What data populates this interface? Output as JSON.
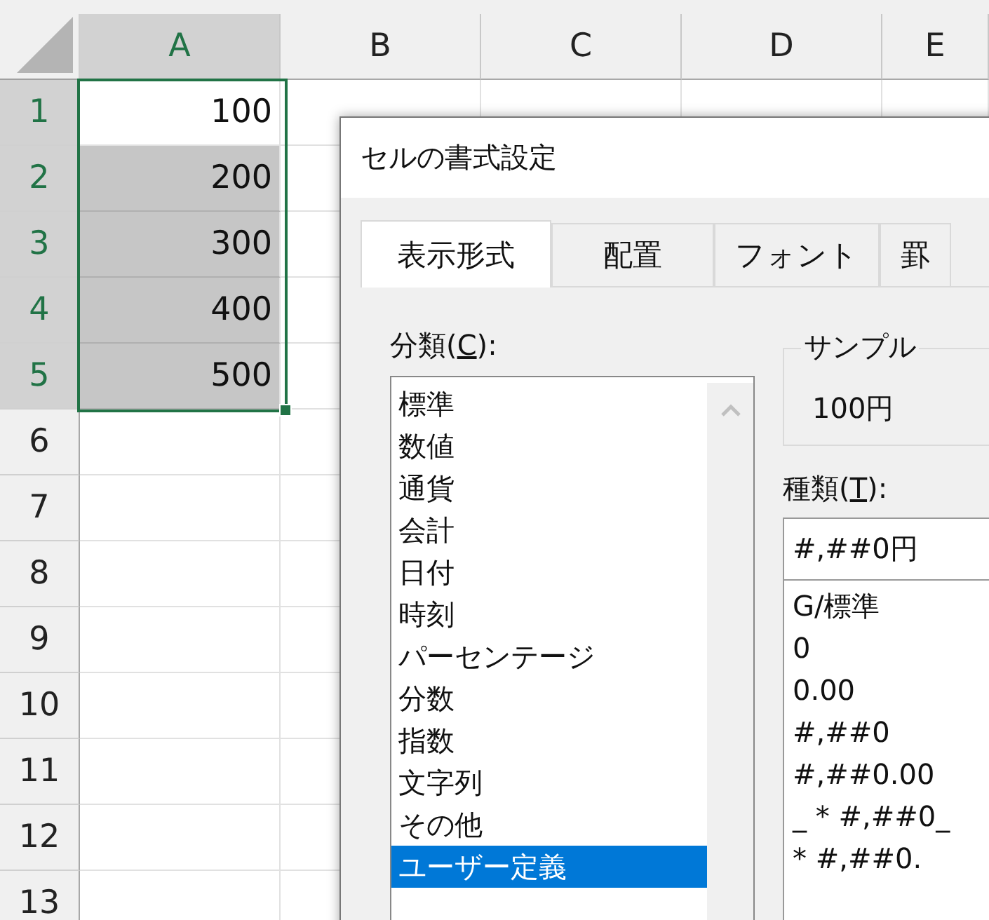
{
  "sheet": {
    "columns": [
      {
        "label": "A",
        "selected": true
      },
      {
        "label": "B",
        "selected": false
      },
      {
        "label": "C",
        "selected": false
      },
      {
        "label": "D",
        "selected": false
      },
      {
        "label": "E",
        "selected": false
      }
    ],
    "rows": [
      {
        "number": "1",
        "selected": true,
        "cells": [
          {
            "value": "100",
            "selected": true,
            "active": true
          }
        ]
      },
      {
        "number": "2",
        "selected": true,
        "cells": [
          {
            "value": "200",
            "selected": true,
            "active": false
          }
        ]
      },
      {
        "number": "3",
        "selected": true,
        "cells": [
          {
            "value": "300",
            "selected": true,
            "active": false
          }
        ]
      },
      {
        "number": "4",
        "selected": true,
        "cells": [
          {
            "value": "400",
            "selected": true,
            "active": false
          }
        ]
      },
      {
        "number": "5",
        "selected": true,
        "cells": [
          {
            "value": "500",
            "selected": true,
            "active": false
          }
        ]
      },
      {
        "number": "6",
        "selected": false,
        "cells": []
      },
      {
        "number": "7",
        "selected": false,
        "cells": []
      },
      {
        "number": "8",
        "selected": false,
        "cells": []
      },
      {
        "number": "9",
        "selected": false,
        "cells": []
      },
      {
        "number": "10",
        "selected": false,
        "cells": []
      },
      {
        "number": "11",
        "selected": false,
        "cells": []
      },
      {
        "number": "12",
        "selected": false,
        "cells": []
      },
      {
        "number": "13",
        "selected": false,
        "cells": []
      }
    ]
  },
  "dialog": {
    "title": "セルの書式設定",
    "tabs": [
      {
        "label": "表示形式",
        "selected": true
      },
      {
        "label": "配置",
        "selected": false
      },
      {
        "label": "フォント",
        "selected": false
      },
      {
        "label": "罫",
        "selected": false
      }
    ],
    "category_label": {
      "before": "分類(",
      "key": "C",
      "after": "):"
    },
    "categories": [
      {
        "label": "標準",
        "selected": false
      },
      {
        "label": "数値",
        "selected": false
      },
      {
        "label": "通貨",
        "selected": false
      },
      {
        "label": "会計",
        "selected": false
      },
      {
        "label": "日付",
        "selected": false
      },
      {
        "label": "時刻",
        "selected": false
      },
      {
        "label": "パーセンテージ",
        "selected": false
      },
      {
        "label": "分数",
        "selected": false
      },
      {
        "label": "指数",
        "selected": false
      },
      {
        "label": "文字列",
        "selected": false
      },
      {
        "label": "その他",
        "selected": false
      },
      {
        "label": "ユーザー定義",
        "selected": true
      }
    ],
    "sample": {
      "legend": "サンプル",
      "value": "100円"
    },
    "type_label": {
      "before": "種類(",
      "key": "T",
      "after": "):"
    },
    "type_value": "#,##0円",
    "types": [
      "G/標準",
      "0",
      "0.00",
      "#,##0",
      "#,##0.00",
      "_ * #,##0_",
      "* #,##0."
    ]
  }
}
